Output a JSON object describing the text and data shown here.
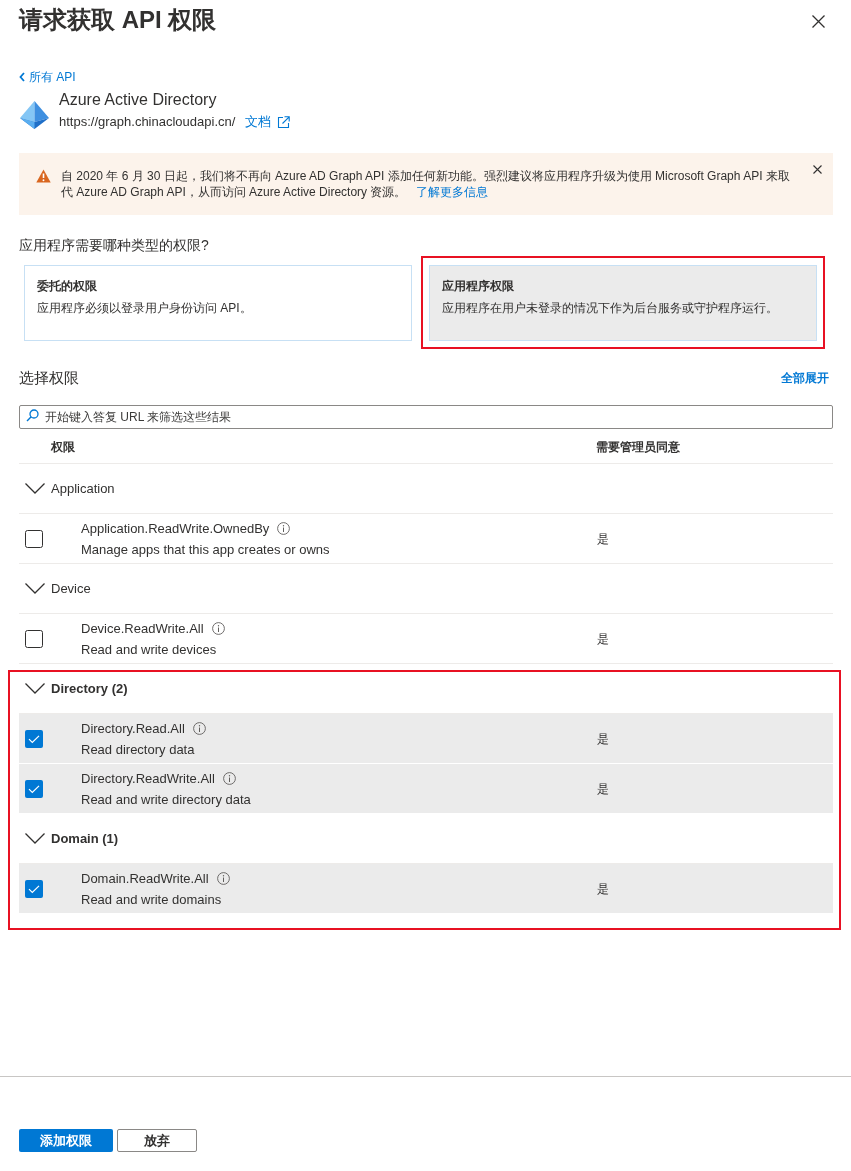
{
  "panel": {
    "title": "请求获取 API 权限"
  },
  "back_link": {
    "label": "所有 API"
  },
  "api": {
    "name": "Azure Active Directory",
    "url": "https://graph.chinacloudapi.cn/",
    "docs_link": "文档"
  },
  "warning": {
    "message": "自 2020 年 6 月 30 日起，我们将不再向 Azure AD Graph API 添加任何新功能。强烈建议将应用程序升级为使用 Microsoft Graph API 来取代 Azure AD Graph API，从而访问 Azure Active Directory 资源。",
    "link": "了解更多信息"
  },
  "permission_type_question": "应用程序需要哪种类型的权限?",
  "permission_types": [
    {
      "title": "委托的权限",
      "description": "应用程序必须以登录用户身份访问 API。",
      "selected": false,
      "highlighted": false
    },
    {
      "title": "应用程序权限",
      "description": "应用程序在用户未登录的情况下作为后台服务或守护程序运行。",
      "selected": true,
      "highlighted": true
    }
  ],
  "select_permissions": {
    "heading": "选择权限",
    "expand_all": "全部展开",
    "search": {
      "placeholder": "开始键入答复 URL 来筛选这些结果"
    },
    "columns": [
      "权限",
      "需要管理员同意"
    ]
  },
  "groups": [
    {
      "label": "Application",
      "expanded": true,
      "highlighted": false,
      "items": [
        {
          "name": "Application.ReadWrite.OwnedBy",
          "description": "Manage apps that this app creates or owns",
          "admin_consent": "是",
          "checked": false
        }
      ]
    },
    {
      "label": "Device",
      "expanded": true,
      "highlighted": false,
      "items": [
        {
          "name": "Device.ReadWrite.All",
          "description": "Read and write devices",
          "admin_consent": "是",
          "checked": false
        }
      ]
    },
    {
      "label": "Directory (2)",
      "expanded": true,
      "highlighted": true,
      "items": [
        {
          "name": "Directory.Read.All",
          "description": "Read directory data",
          "admin_consent": "是",
          "checked": true
        },
        {
          "name": "Directory.ReadWrite.All",
          "description": "Read and write directory data",
          "admin_consent": "是",
          "checked": true
        }
      ]
    },
    {
      "label": "Domain (1)",
      "expanded": true,
      "highlighted": true,
      "items": [
        {
          "name": "Domain.ReadWrite.All",
          "description": "Read and write domains",
          "admin_consent": "是",
          "checked": true
        }
      ]
    }
  ],
  "footer": {
    "buttons": [
      {
        "label": "添加权限",
        "kind": "primary"
      },
      {
        "label": "放弃",
        "kind": "secondary"
      }
    ]
  }
}
